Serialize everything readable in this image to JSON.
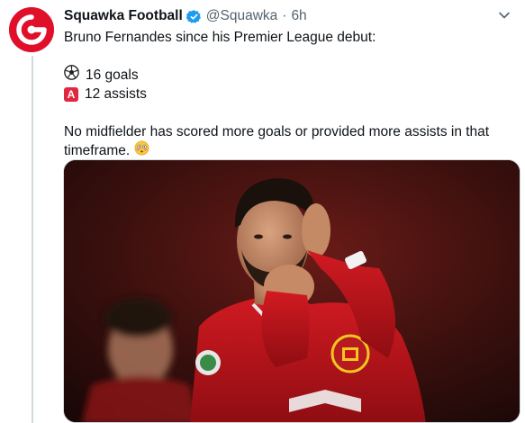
{
  "author": {
    "display_name": "Squawka Football",
    "handle": "@Squawka",
    "separator": "·",
    "time": "6h",
    "avatar_icon": "squawka-logo-icon",
    "verified_icon": "verified-badge-icon"
  },
  "tweet": {
    "line1": "Bruno Fernandes since his Premier League debut:",
    "goals_emoji": "soccer-ball-icon",
    "goals": "16 goals",
    "assists_emoji": "a-button-icon",
    "assists_letter": "A",
    "assists": "12 assists",
    "line3": "No midfielder has scored more goals or provided more assists in that",
    "line4": "timeframe.",
    "end_emoji": "flushed-face-icon"
  },
  "colors": {
    "brand_red": "#e0102a",
    "verified_blue": "#1d9bf0",
    "secondary_text": "#536471",
    "kit_red": "#c8161d"
  }
}
